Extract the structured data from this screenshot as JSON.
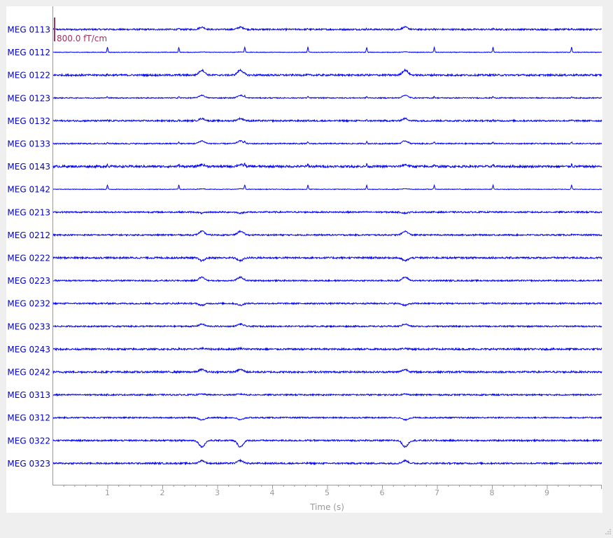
{
  "chart_data": {
    "type": "line",
    "title": "",
    "xlabel": "Time (s)",
    "ylabel": "",
    "xlim": [
      0,
      10
    ],
    "x_ticks": [
      1,
      2,
      3,
      4,
      5,
      6,
      7,
      8,
      9
    ],
    "minor_tick_step": 0.2,
    "scale_bar_label": "800.0 fT/cm",
    "trace_color": "#0000ff",
    "label_color": "#0000cc",
    "scale_color": "#a0305c",
    "axis_color": "#999999",
    "evoked_peaks_s": [
      2.72,
      3.42,
      6.42
    ],
    "spike_times_s": [
      1.0,
      2.3,
      3.5,
      4.65,
      5.72,
      6.95,
      8.02,
      9.45
    ],
    "channels": [
      {
        "name": "MEG 0113",
        "noise": 0.16,
        "peak_amp": 0.45,
        "spike_amp": 0.15
      },
      {
        "name": "MEG 0112",
        "noise": 0.06,
        "peak_amp": 0.08,
        "spike_amp": 1.0
      },
      {
        "name": "MEG 0122",
        "noise": 0.18,
        "peak_amp": 1.0,
        "spike_amp": 0.08
      },
      {
        "name": "MEG 0123",
        "noise": 0.1,
        "peak_amp": 0.55,
        "spike_amp": 0.3
      },
      {
        "name": "MEG 0132",
        "noise": 0.16,
        "peak_amp": 0.45,
        "spike_amp": 0.12
      },
      {
        "name": "MEG 0133",
        "noise": 0.12,
        "peak_amp": 0.55,
        "spike_amp": 0.35
      },
      {
        "name": "MEG 0143",
        "noise": 0.22,
        "peak_amp": 0.35,
        "spike_amp": 0.45
      },
      {
        "name": "MEG 0142",
        "noise": 0.06,
        "peak_amp": 0.1,
        "spike_amp": 0.85
      },
      {
        "name": "MEG 0213",
        "noise": 0.15,
        "peak_amp": -0.2,
        "spike_amp": 0.05
      },
      {
        "name": "MEG 0212",
        "noise": 0.14,
        "peak_amp": 0.75,
        "spike_amp": 0.08
      },
      {
        "name": "MEG 0222",
        "noise": 0.18,
        "peak_amp": -0.6,
        "spike_amp": 0.05
      },
      {
        "name": "MEG 0223",
        "noise": 0.14,
        "peak_amp": 0.7,
        "spike_amp": 0.05
      },
      {
        "name": "MEG 0232",
        "noise": 0.15,
        "peak_amp": -0.35,
        "spike_amp": 0.05
      },
      {
        "name": "MEG 0233",
        "noise": 0.14,
        "peak_amp": 0.45,
        "spike_amp": 0.05
      },
      {
        "name": "MEG 0243",
        "noise": 0.18,
        "peak_amp": 0.15,
        "spike_amp": 0.05
      },
      {
        "name": "MEG 0242",
        "noise": 0.18,
        "peak_amp": 0.5,
        "spike_amp": 0.05
      },
      {
        "name": "MEG 0313",
        "noise": 0.14,
        "peak_amp": 0.15,
        "spike_amp": 0.05
      },
      {
        "name": "MEG 0312",
        "noise": 0.13,
        "peak_amp": -0.45,
        "spike_amp": 0.05
      },
      {
        "name": "MEG 0322",
        "noise": 0.16,
        "peak_amp": -1.3,
        "spike_amp": 0.05
      },
      {
        "name": "MEG 0323",
        "noise": 0.16,
        "peak_amp": 0.55,
        "spike_amp": 0.05
      }
    ]
  }
}
